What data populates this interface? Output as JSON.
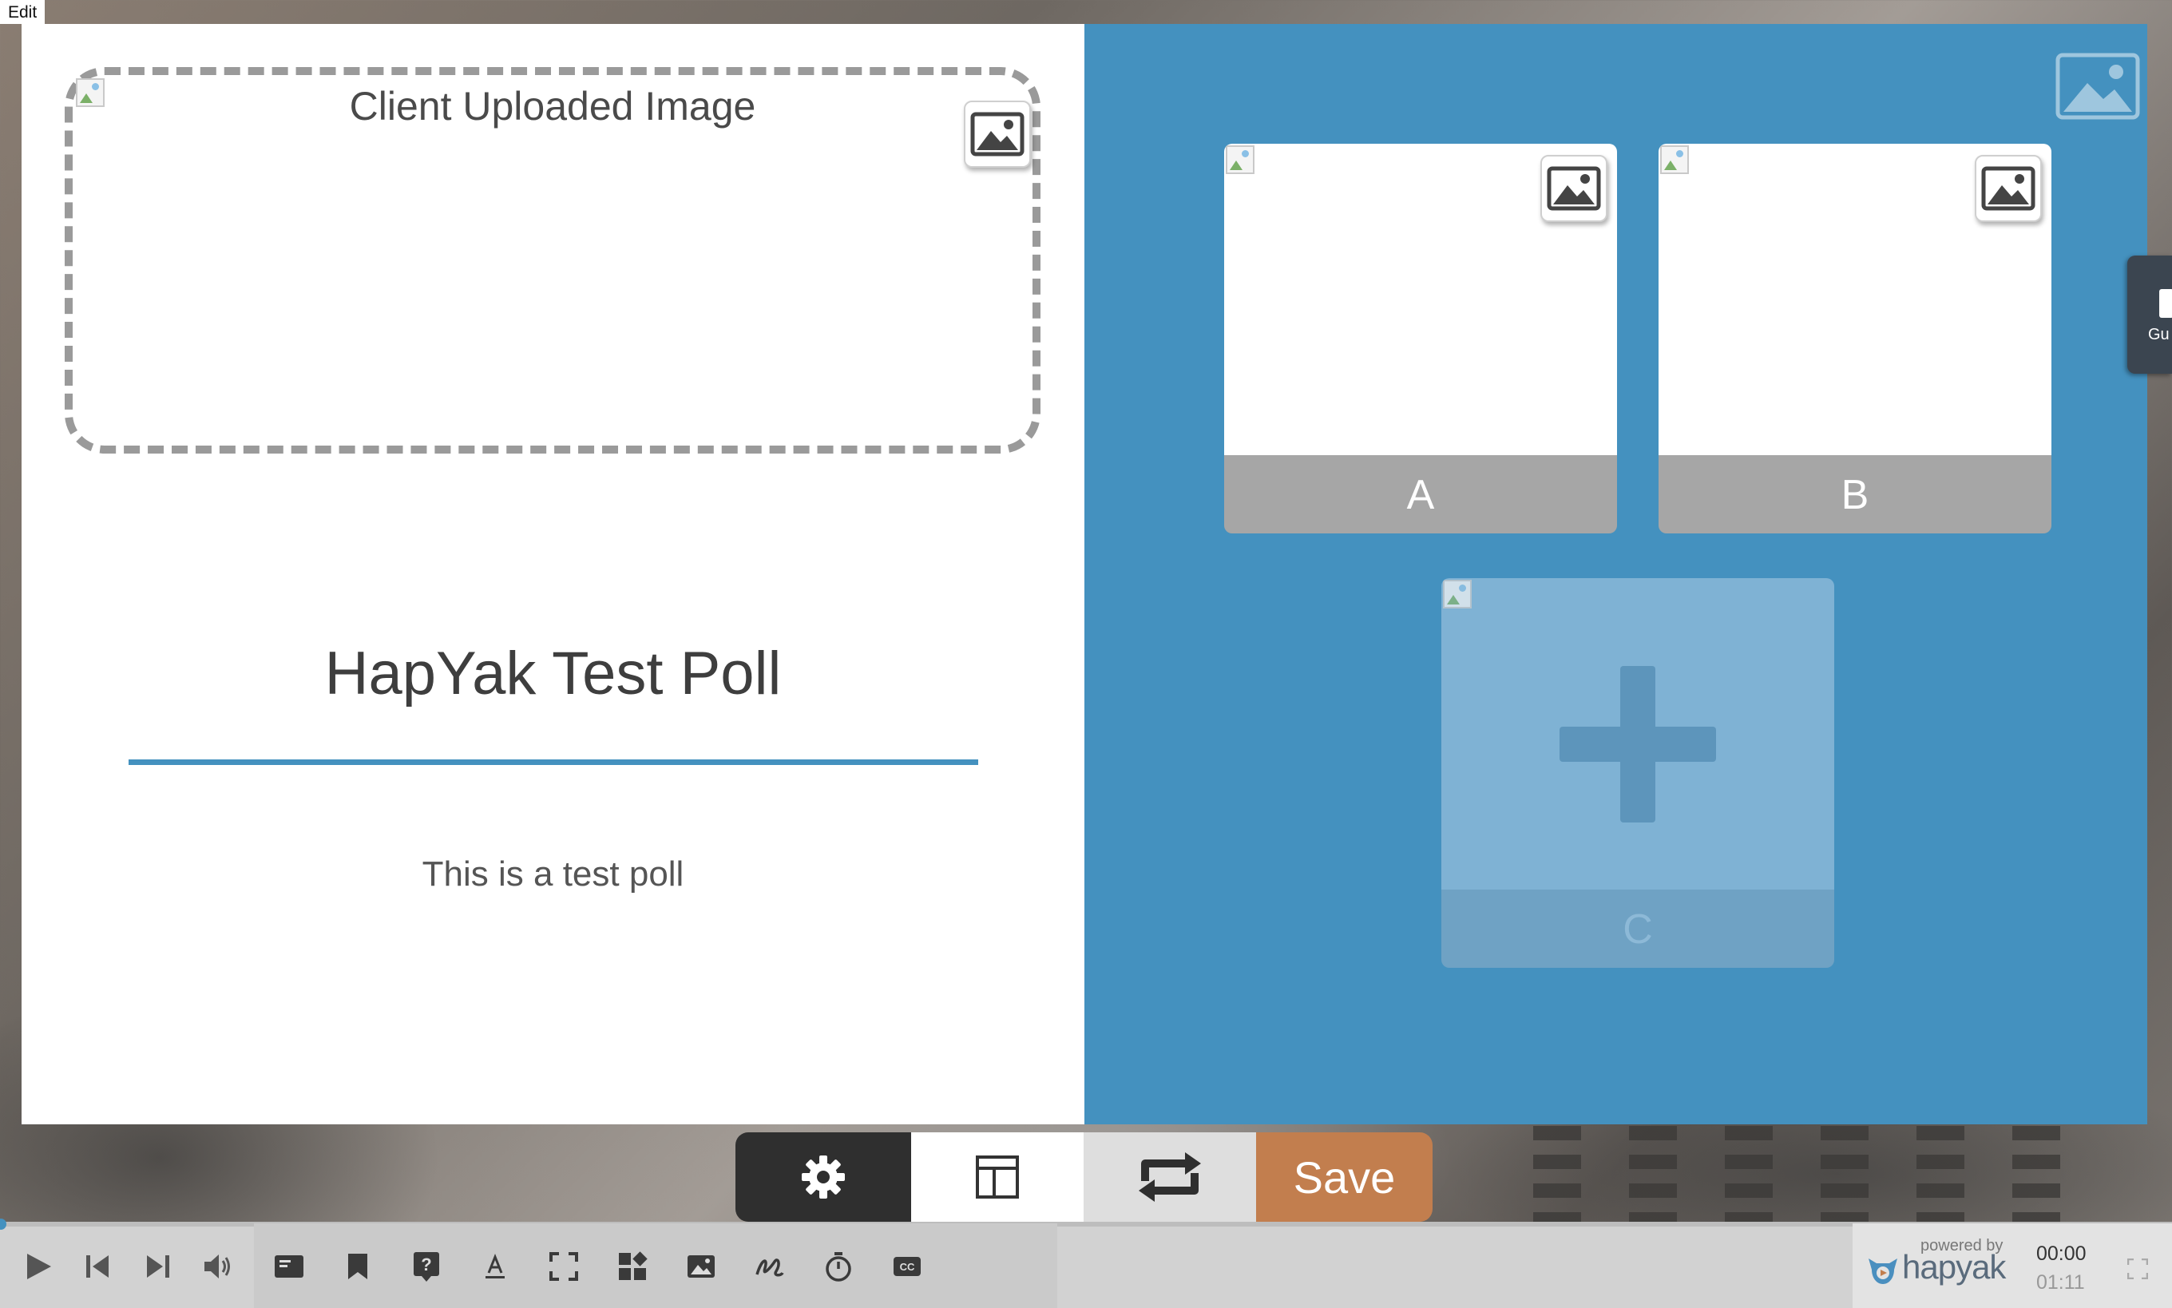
{
  "edit_label": "Edit",
  "poll": {
    "upload_title": "Client Uploaded Image",
    "title": "HapYak Test Poll",
    "description": "This is a test poll",
    "answers": [
      {
        "label": "A"
      },
      {
        "label": "B"
      },
      {
        "label": "C"
      }
    ]
  },
  "guide_tab": {
    "label": "Gu"
  },
  "toolbar": {
    "save_label": "Save",
    "settings_icon": "gear-icon",
    "layout_icon": "layout-icon",
    "swap_icon": "swap-icon"
  },
  "player": {
    "icons": [
      "play-icon",
      "skip-back-icon",
      "skip-forward-icon",
      "volume-icon"
    ],
    "tools": [
      "text-annotation-icon",
      "bookmark-icon",
      "quiz-icon",
      "text-icon",
      "hotspot-icon",
      "widget-icon",
      "image-icon",
      "draw-icon",
      "timer-icon",
      "captions-icon"
    ],
    "powered_by": "powered by",
    "brand": "hapyak",
    "current_time": "00:00",
    "total_time": "01:11"
  },
  "colors": {
    "accent_blue": "#4491bf",
    "save_orange": "#c27e4e",
    "answer_label_gray": "#a6a6a6"
  }
}
